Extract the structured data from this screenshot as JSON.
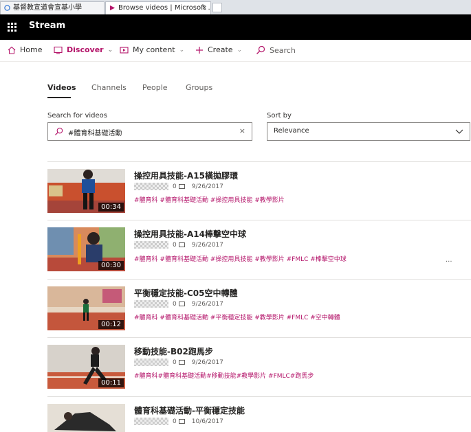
{
  "browser": {
    "tabs": [
      {
        "title": "基督教宣道會宣基小學"
      },
      {
        "title": "Browse videos | Microsoft ..."
      }
    ],
    "close_glyph": "×"
  },
  "header": {
    "app_name": "Stream"
  },
  "nav": {
    "home": "Home",
    "discover": "Discover",
    "my_content": "My content",
    "create": "Create",
    "search": "Search"
  },
  "page_tabs": [
    "Videos",
    "Channels",
    "People",
    "Groups"
  ],
  "search": {
    "label": "Search for videos",
    "value": "#體育科基礎活動",
    "clear": "×"
  },
  "sort": {
    "label": "Sort by",
    "value": "Relevance"
  },
  "more_glyph": "...",
  "videos": [
    {
      "title": "操控用具技能-A15橫拋膠環",
      "duration": "00:34",
      "comments": "0",
      "date": "9/26/2017",
      "tags": "#體育科 #體育科基礎活動 #操控用具技能 #教學影片"
    },
    {
      "title": "操控用具技能-A14棒擊空中球",
      "duration": "00:30",
      "comments": "0",
      "date": "9/26/2017",
      "tags": "#體育科 #體育科基礎活動 #操控用具技能 #教學影片 #FMLC #棒擊空中球"
    },
    {
      "title": "平衡穩定技能-C05空中轉體",
      "duration": "00:12",
      "comments": "0",
      "date": "9/26/2017",
      "tags": "#體育科 #體育科基礎活動 #平衡穩定技能 #教學影片 #FMLC #空中轉體"
    },
    {
      "title": "移動技能-B02跑馬步",
      "duration": "00:11",
      "comments": "0",
      "date": "9/26/2017",
      "tags": "#體育科#體育科基礎活動#移動技能#教學影片 #FMLC#跑馬步"
    },
    {
      "title": "體育科基礎活動-平衡穩定技能",
      "duration": "",
      "comments": "0",
      "date": "10/6/2017",
      "tags": ""
    }
  ],
  "colors": {
    "accent": "#b4156a",
    "header_bg": "#000000"
  }
}
